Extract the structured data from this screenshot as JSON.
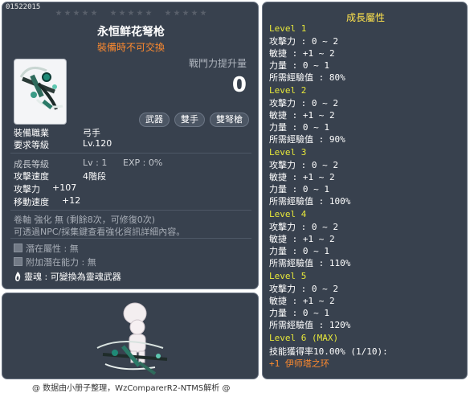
{
  "item": {
    "id": "01522015",
    "name": "永恒鲜花弩枪",
    "trade_note": "裝備時不可交換",
    "power_label": "戰鬥力提升量",
    "power_value": "0",
    "tags": [
      "武器",
      "雙手",
      "雙弩槍"
    ],
    "stars_count": 15
  },
  "requirements": {
    "job_label": "裝備職業",
    "job_value": "弓手",
    "level_label": "要求等級",
    "level_value": "Lv.120"
  },
  "growth_info": {
    "label": "成長等級",
    "lv": "Lv : 1",
    "exp": "EXP : 0%"
  },
  "stats": {
    "speed_label": "攻擊速度",
    "speed_value": "4階段",
    "attack_label": "攻擊力",
    "attack_value": "+107",
    "move_label": "移動速度",
    "move_value": "+12"
  },
  "upgrade": {
    "line1": "卷軸 強化 無 (剩餘8次，可修復0次)",
    "line2": "可透過NPC/採集鍵查看強化資訊詳細內容。"
  },
  "potential": {
    "potential_label": "潛在屬性",
    "potential_value": ": 無",
    "bonus_label": "附加潛在能力",
    "bonus_value": ": 無"
  },
  "soul": {
    "label": "靈魂",
    "value": ": 可變換為靈魂武器"
  },
  "growth_panel": {
    "title": "成長屬性",
    "levels": [
      {
        "name": "Level 1",
        "lines": [
          "攻擊力 : 0 ~ 2",
          "敏捷 : +1 ~ 2",
          "力量 : 0 ~ 1",
          "所需經驗值 : 80%"
        ]
      },
      {
        "name": "Level 2",
        "lines": [
          "攻擊力 : 0 ~ 2",
          "敏捷 : +1 ~ 2",
          "力量 : 0 ~ 1",
          "所需經驗值 : 90%"
        ]
      },
      {
        "name": "Level 3",
        "lines": [
          "攻擊力 : 0 ~ 2",
          "敏捷 : +1 ~ 2",
          "力量 : 0 ~ 1",
          "所需經驗值 : 100%"
        ]
      },
      {
        "name": "Level 4",
        "lines": [
          "攻擊力 : 0 ~ 2",
          "敏捷 : +1 ~ 2",
          "力量 : 0 ~ 1",
          "所需經驗值 : 110%"
        ]
      },
      {
        "name": "Level 5",
        "lines": [
          "攻擊力 : 0 ~ 2",
          "敏捷 : +1 ~ 2",
          "力量 : 0 ~ 1",
          "所需經驗值 : 120%"
        ]
      }
    ],
    "max_level": "Level 6 (MAX)",
    "max_line": "技能獲得率10.00% (1/10):",
    "max_skill": "+1 伊师塔之环"
  },
  "footer": "@ 数据由小册子整理，WzComparerR2-NTMS解析 @",
  "colors": {
    "panel": "#38414e",
    "yellow": "#e7e83a",
    "orange": "#ff8a2e"
  }
}
